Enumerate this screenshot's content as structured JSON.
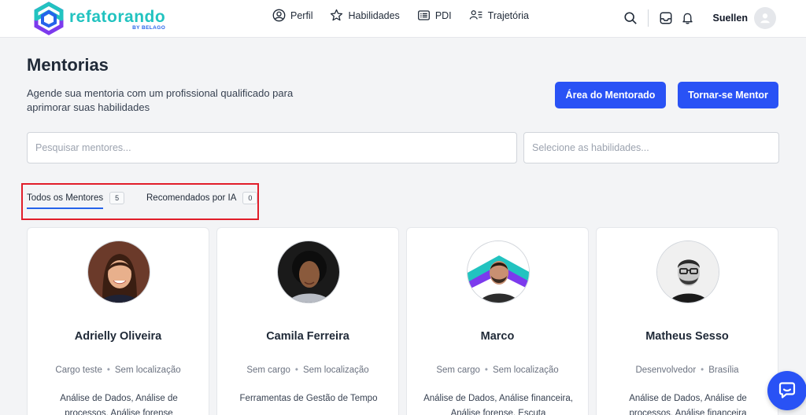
{
  "brand": {
    "name": "refatorando",
    "sub": "BY BELAGO",
    "color": "#22c3c0"
  },
  "nav": [
    {
      "label": "Perfil",
      "icon": "user-circle-icon"
    },
    {
      "label": "Habilidades",
      "icon": "star-icon"
    },
    {
      "label": "PDI",
      "icon": "list-card-icon"
    },
    {
      "label": "Trajetória",
      "icon": "user-list-icon"
    }
  ],
  "header": {
    "user_name": "Suellen"
  },
  "page": {
    "title": "Mentorias",
    "description": "Agende sua mentoria com um profissional qualificado para aprimorar suas habilidades",
    "btn_mentorado": "Área do Mentorado",
    "btn_mentor": "Tornar-se Mentor",
    "accent": "#2952f5"
  },
  "filters": {
    "search_placeholder": "Pesquisar mentores...",
    "skills_placeholder": "Selecione as habilidades..."
  },
  "tabs": [
    {
      "label": "Todos os Mentores",
      "count": "5",
      "active": true
    },
    {
      "label": "Recomendados por IA",
      "count": "0",
      "active": false
    }
  ],
  "mentors": [
    {
      "name": "Adrielly Oliveira",
      "role": "Cargo teste",
      "location": "Sem localização",
      "skills": "Análise de Dados, Análise de processos, Análise forense"
    },
    {
      "name": "Camila Ferreira",
      "role": "Sem cargo",
      "location": "Sem localização",
      "skills": "Ferramentas de Gestão de Tempo"
    },
    {
      "name": "Marco",
      "role": "Sem cargo",
      "location": "Sem localização",
      "skills": "Análise de Dados, Análise financeira, Análise forense, Escuta"
    },
    {
      "name": "Matheus Sesso",
      "role": "Desenvolvedor",
      "location": "Brasília",
      "skills": "Análise de Dados, Análise de processos, Análise financeira"
    }
  ],
  "separator": "•"
}
